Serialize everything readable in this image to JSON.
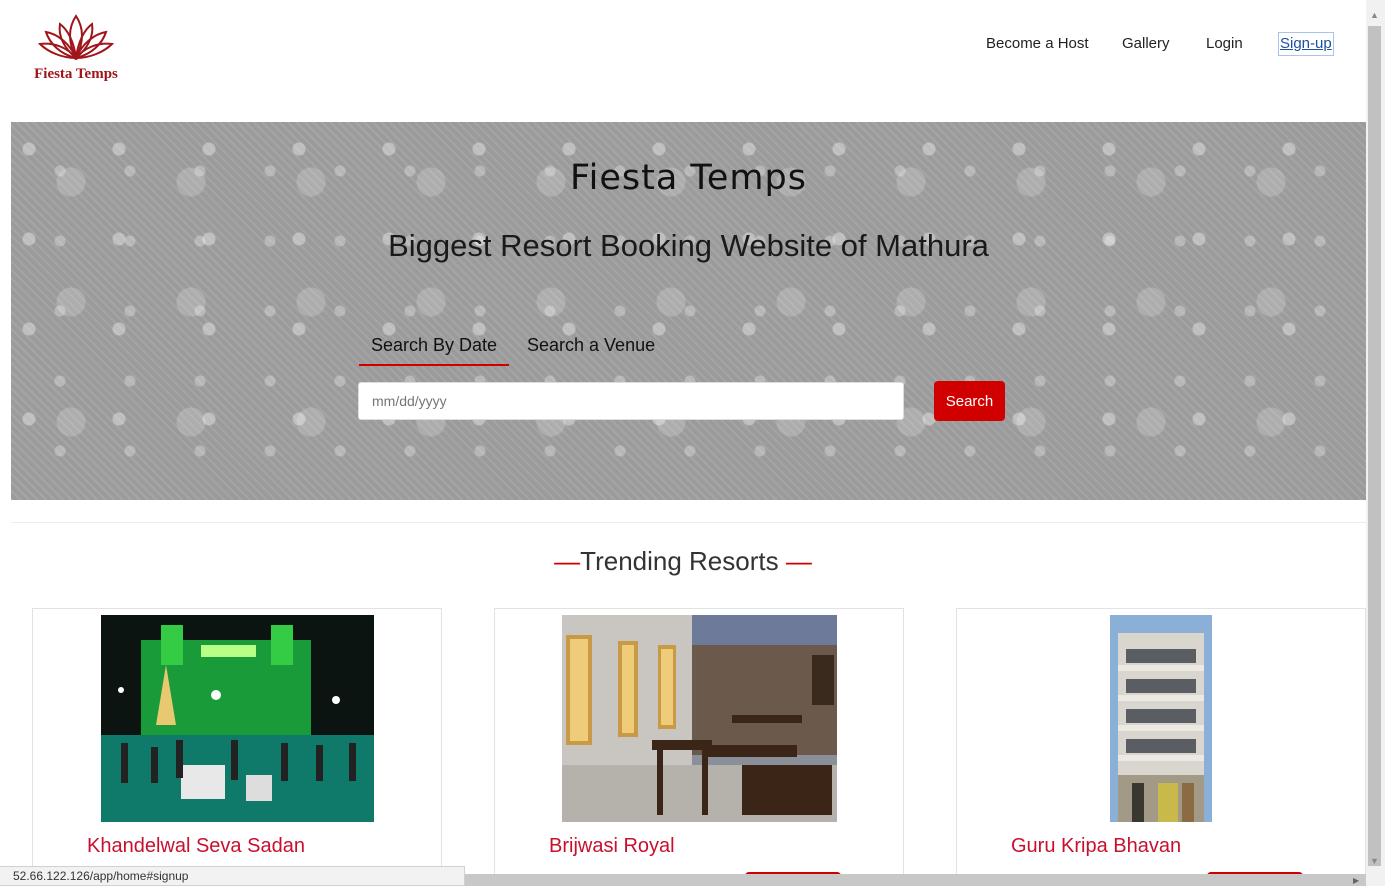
{
  "brand": {
    "name": "Fiesta Temps",
    "logo_color": "#a0151b"
  },
  "nav": {
    "become_host": "Become a Host",
    "gallery": "Gallery",
    "login": "Login",
    "signup": "Sign-up"
  },
  "hero": {
    "title": "Fiesta Temps",
    "subtitle": "Biggest Resort Booking Website of Mathura",
    "tabs": [
      "Search By Date",
      "Search a Venue"
    ],
    "date_placeholder": "mm/dd/yyyy",
    "search_label": "Search"
  },
  "trending": {
    "title": "Trending Resorts",
    "dash": "—",
    "resorts": [
      {
        "name": "Khandelwal Seva Sadan"
      },
      {
        "name": "Brijwasi Royal"
      },
      {
        "name": "Guru Kripa Bhavan"
      }
    ]
  },
  "status_bar": {
    "url": "52.66.122.126/app/home#signup"
  },
  "colors": {
    "accent": "#d10000",
    "resort_name": "#c8102e",
    "link": "#1a4fa5"
  }
}
